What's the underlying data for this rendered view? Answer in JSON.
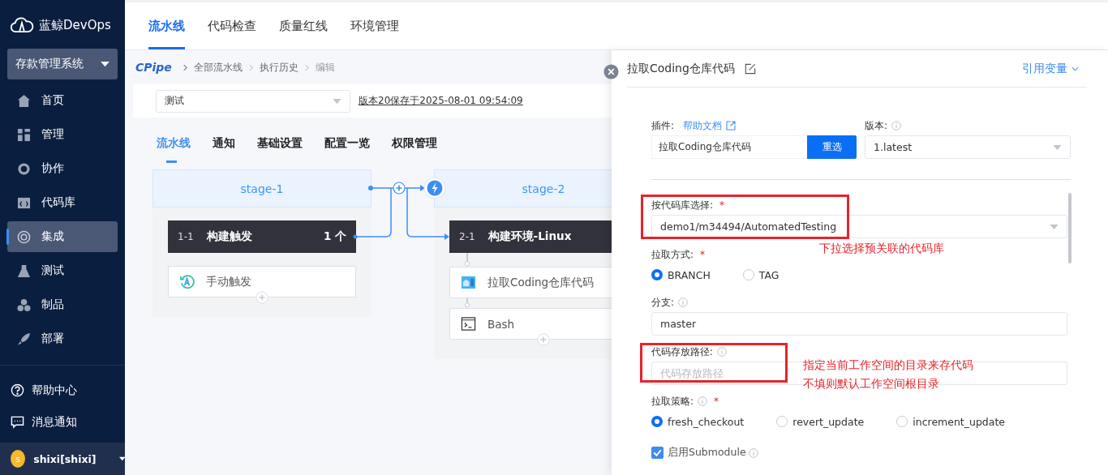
{
  "logo": {
    "text": "蓝鲸DevOps"
  },
  "project": {
    "name": "存款管理系统"
  },
  "nav": [
    {
      "label": "首页",
      "selected": false
    },
    {
      "label": "管理",
      "selected": false
    },
    {
      "label": "协作",
      "selected": false
    },
    {
      "label": "代码库",
      "selected": false
    },
    {
      "label": "集成",
      "selected": true
    },
    {
      "label": "测试",
      "selected": false
    },
    {
      "label": "制品",
      "selected": false
    },
    {
      "label": "部署",
      "selected": false
    }
  ],
  "sidebar_footer": [
    {
      "label": "帮助中心"
    },
    {
      "label": "消息通知"
    }
  ],
  "user": {
    "avatar": "s",
    "name": "shixi[shixi]"
  },
  "top_tabs": [
    {
      "label": "流水线",
      "selected": true
    },
    {
      "label": "代码检查",
      "selected": false
    },
    {
      "label": "质量红线",
      "selected": false
    },
    {
      "label": "环境管理",
      "selected": false
    }
  ],
  "breadcrumb": {
    "brand": "CPipe",
    "items": [
      "全部流水线",
      "执行历史",
      "编辑"
    ]
  },
  "pipeline_select": {
    "value": "测试"
  },
  "version_link": "版本20保存于2025-08-01 09:54:09",
  "sub_tabs": [
    {
      "label": "流水线",
      "selected": true
    },
    {
      "label": "通知",
      "selected": false
    },
    {
      "label": "基础设置",
      "selected": false
    },
    {
      "label": "配置一览",
      "selected": false
    },
    {
      "label": "权限管理",
      "selected": false
    }
  ],
  "stages": [
    {
      "name": "stage-1",
      "jobs": [
        {
          "index": "1-1",
          "name": "构建触发",
          "count": "1 个",
          "steps": [
            {
              "name": "手动触发",
              "kind": "trigger"
            }
          ]
        }
      ]
    },
    {
      "name": "stage-2",
      "jobs": [
        {
          "index": "2-1",
          "name": "构建环境-Linux",
          "steps": [
            {
              "name": "拉取Coding仓库代码",
              "kind": "repo"
            },
            {
              "name": "Bash",
              "kind": "terminal"
            }
          ]
        }
      ]
    }
  ],
  "drawer": {
    "title": "拉取Coding仓库代码",
    "variables_link": "引用变量",
    "plugin": {
      "label": "插件:",
      "help_link": "帮助文档",
      "value": "拉取Coding仓库代码",
      "button": "重选"
    },
    "version": {
      "label": "版本:",
      "value": "1.latest"
    },
    "fields": [
      {
        "kind": "select",
        "label": "按代码库选择:",
        "required_mark": "*",
        "info": false,
        "value": "demo1/m34494/AutomatedTesting",
        "highlighted": true,
        "note": [
          "下拉选择预关联的代码库"
        ]
      },
      {
        "kind": "radio",
        "label": "拉取方式:",
        "required_mark": "*",
        "info": false,
        "options": [
          {
            "label": "BRANCH",
            "selected": true
          },
          {
            "label": "TAG",
            "selected": false
          }
        ]
      },
      {
        "kind": "input",
        "label": "分支:",
        "info": true,
        "value": "master"
      },
      {
        "kind": "input",
        "label": "代码存放路径:",
        "info": true,
        "placeholder": "代码存放路径",
        "highlighted": true,
        "note": [
          "指定当前工作空间的目录来存代码",
          "不填则默认工作空间根目录"
        ]
      },
      {
        "kind": "radio",
        "label": "拉取策略:",
        "required_mark": "*",
        "info": true,
        "options": [
          {
            "label": "fresh_checkout",
            "selected": true
          },
          {
            "label": "revert_update",
            "selected": false
          },
          {
            "label": "increment_update",
            "selected": false
          }
        ]
      },
      {
        "kind": "checkbox",
        "label": "启用Submodule",
        "info": true,
        "checked": true
      }
    ]
  }
}
